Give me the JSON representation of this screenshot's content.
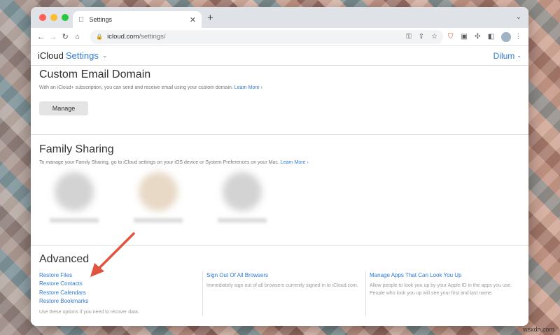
{
  "browser": {
    "tab_title": "Settings",
    "url_domain": "icloud.com",
    "url_path": "/settings/",
    "new_tab_label": "+"
  },
  "icloud_header": {
    "brand": "iCloud",
    "section": "Settings",
    "user": "Dilum"
  },
  "custom_email": {
    "title": "Custom Email Domain",
    "description": "With an iCloud+ subscription, you can send and receive email using your custom domain.",
    "learn_more": "Learn More",
    "manage_label": "Manage"
  },
  "family_sharing": {
    "title": "Family Sharing",
    "description": "To manage your Family Sharing, go to iCloud settings on your iOS device or System Preferences on your Mac.",
    "learn_more": "Learn More"
  },
  "advanced": {
    "title": "Advanced",
    "restore_items": [
      "Restore Files",
      "Restore Contacts",
      "Restore Calendars",
      "Restore Bookmarks"
    ],
    "restore_note": "Use these options if you need to recover data.",
    "sign_out_link": "Sign Out Of All Browsers",
    "sign_out_desc": "Immediately sign out of all browsers currently signed in to iCloud.com.",
    "manage_apps_link": "Manage Apps That Can Look You Up",
    "manage_apps_desc": "Allow people to look you up by your Apple ID in the apps you use. People who look you up will see your first and last name."
  },
  "annotation": {
    "arrow_color": "#e0533f"
  },
  "accent_color": "#2f7ad6",
  "watermark": "wsxdn.com"
}
